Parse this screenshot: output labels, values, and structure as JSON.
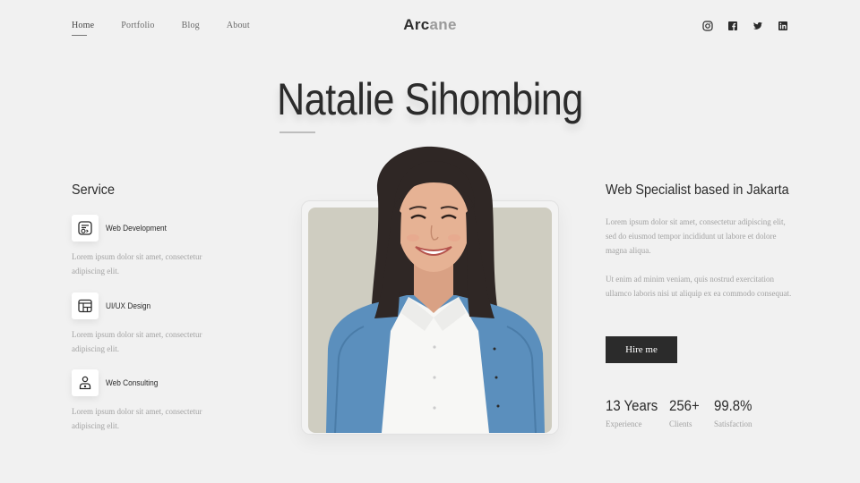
{
  "nav": {
    "links": [
      "Home",
      "Portfolio",
      "Blog",
      "About"
    ],
    "logo_dark": "Arc",
    "logo_light": "ane",
    "socials": [
      "instagram-icon",
      "facebook-icon",
      "twitter-icon",
      "linkedin-icon"
    ]
  },
  "hero": {
    "name": "Natalie Sihombing"
  },
  "services": {
    "heading": "Service",
    "items": [
      {
        "name": "Web Development",
        "icon": "code-window-icon",
        "desc": "Lorem ipsum dolor sit amet, consectetur adipiscing elit."
      },
      {
        "name": "UI/UX Design",
        "icon": "layout-grid-icon",
        "desc": "Lorem ipsum dolor sit amet, consectetur adipiscing elit."
      },
      {
        "name": "Web Consulting",
        "icon": "user-consult-icon",
        "desc": "Lorem ipsum dolor sit amet, consectetur adipiscing elit."
      }
    ]
  },
  "about": {
    "heading": "Web Specialist based in Jakarta",
    "p1": "Lorem ipsum dolor sit amet, consectetur adipiscing elit, sed do eiusmod tempor incididunt ut labore et dolore magna aliqua.",
    "p2": "Ut enim ad minim veniam, quis nostrud exercitation ullamco laboris nisi ut aliquip ex ea commodo consequat.",
    "cta": "Hire me"
  },
  "stats": [
    {
      "value": "13 Years",
      "label": "Experience"
    },
    {
      "value": "256+",
      "label": "Clients"
    },
    {
      "value": "99.8%",
      "label": "Satisfaction"
    }
  ],
  "colors": {
    "background": "#f1f1f1",
    "text": "#2b2b2b",
    "muted": "#a3a3a3",
    "button": "#2b2b2b",
    "photo_bg": "#cfcdc1"
  }
}
